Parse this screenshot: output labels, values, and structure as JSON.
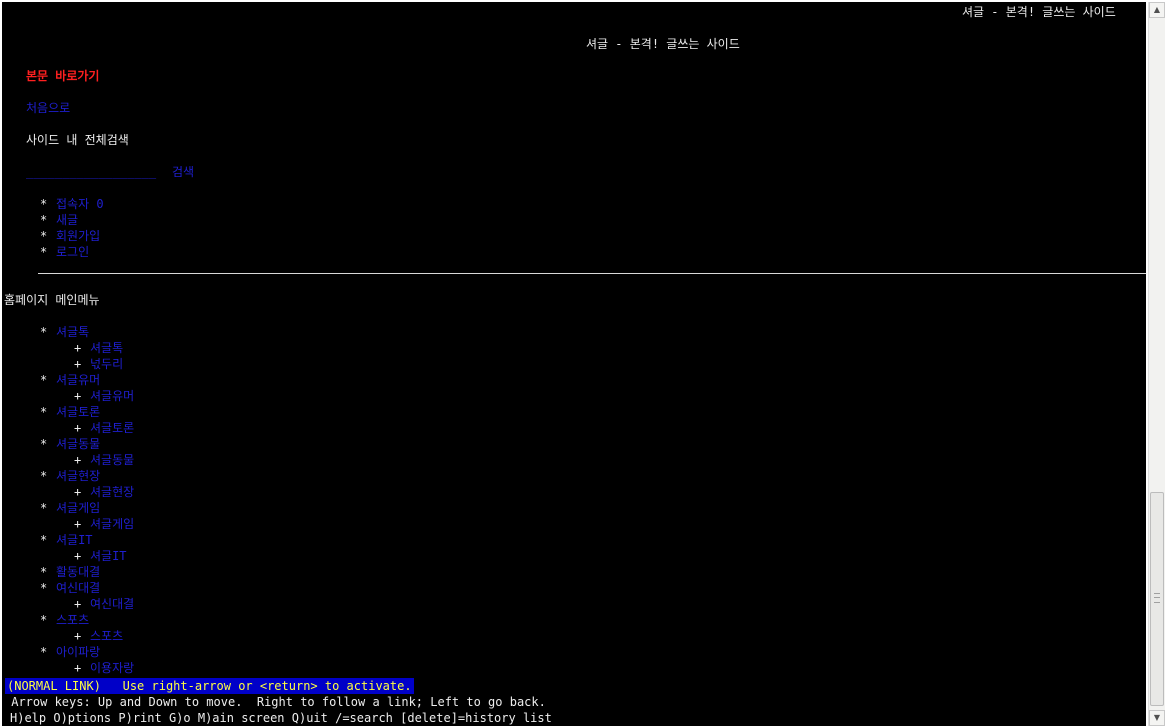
{
  "header": {
    "corner_title": "셔글 - 본격! 글쓰는 사이드",
    "center_title": "셔글 - 본격! 글쓰는 사이드"
  },
  "top_links": {
    "skip_to_content": "본문 바로가기",
    "home": "처음으로",
    "search_heading": "사이드 내 전체검색",
    "search_field": "__________________",
    "search_button": "검색"
  },
  "user_menu": {
    "bullet": "*",
    "items": [
      "접속자 0",
      "새글",
      "회원가입",
      "로그인"
    ]
  },
  "main_menu": {
    "heading": "홈페이지 메인메뉴",
    "bullet": "*",
    "sub_bullet": "+",
    "items": [
      {
        "label": "셔글톡",
        "children": [
          "셔글톡",
          "넋두리"
        ]
      },
      {
        "label": "셔글유머",
        "children": [
          "셔글유머"
        ]
      },
      {
        "label": "셔글토론",
        "children": [
          "셔글토론"
        ]
      },
      {
        "label": "셔글동물",
        "children": [
          "셔글동물"
        ]
      },
      {
        "label": "셔글현장",
        "children": [
          "셔글현장"
        ]
      },
      {
        "label": "셔글게임",
        "children": [
          "셔글게임"
        ]
      },
      {
        "label": "셔글IT",
        "children": [
          "셔글IT"
        ]
      },
      {
        "label": "활동대결",
        "children": []
      },
      {
        "label": "여신대결",
        "children": [
          "여신대결"
        ]
      },
      {
        "label": "스포츠",
        "children": [
          "스포츠"
        ]
      },
      {
        "label": "아이파랑",
        "children": [
          "이용자랑"
        ]
      }
    ]
  },
  "status": {
    "message": "(NORMAL LINK)   Use right-arrow or <return> to activate.",
    "help_line_1": " Arrow keys: Up and Down to move.  Right to follow a link; Left to go back.",
    "help_line_2": "H)elp O)ptions P)rint G)o M)ain screen Q)uit /=search [delete]=history list"
  },
  "scrollbar": {
    "up_icon": "▲",
    "down_icon": "▼"
  }
}
